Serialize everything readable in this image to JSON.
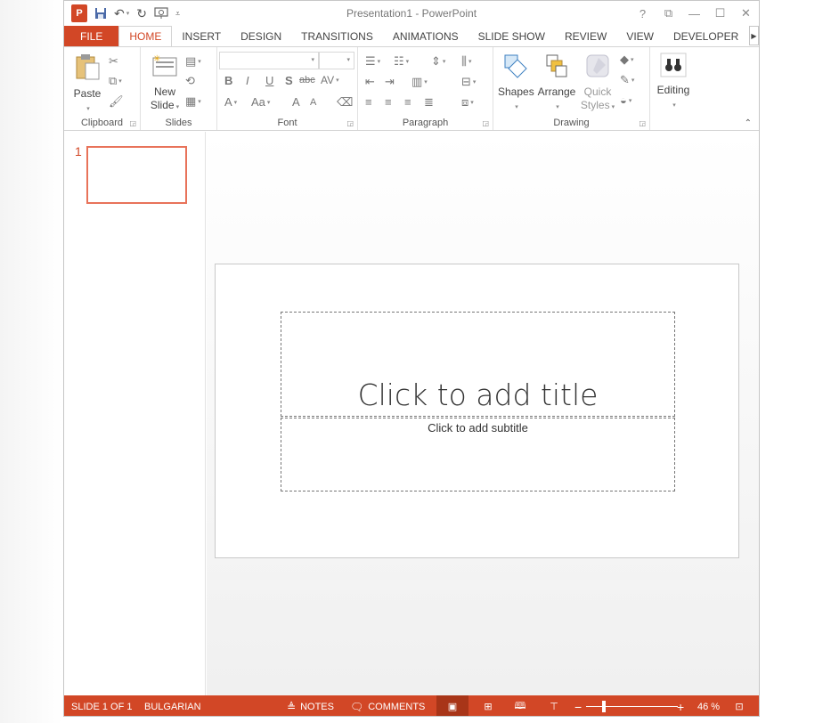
{
  "window": {
    "title": "Presentation1 - PowerPoint"
  },
  "qat": {
    "logo_letter": "P"
  },
  "title_controls": {
    "help": "?",
    "restore_ribbon": "⧉",
    "minimize": "—",
    "maximize": "☐",
    "close": "✕"
  },
  "tabs": [
    {
      "label": "FILE"
    },
    {
      "label": "HOME"
    },
    {
      "label": "INSERT"
    },
    {
      "label": "DESIGN"
    },
    {
      "label": "TRANSITIONS"
    },
    {
      "label": "ANIMATIONS"
    },
    {
      "label": "SLIDE SHOW"
    },
    {
      "label": "REVIEW"
    },
    {
      "label": "VIEW"
    },
    {
      "label": "DEVELOPER"
    }
  ],
  "ribbon": {
    "groups": {
      "clipboard": "Clipboard",
      "slides": "Slides",
      "font": "Font",
      "paragraph": "Paragraph",
      "drawing": "Drawing"
    },
    "paste_label": "Paste",
    "new_slide_label_1": "New",
    "new_slide_label_2": "Slide",
    "shapes_label": "Shapes",
    "arrange_label": "Arrange",
    "quick_styles_label_1": "Quick",
    "quick_styles_label_2": "Styles",
    "editing_label": "Editing",
    "font_buttons": {
      "bold": "B",
      "italic": "I",
      "underline": "U",
      "shadow": "S",
      "strike": "abc",
      "spacing": "AV",
      "font_color": "A",
      "change_case": "Aa",
      "grow": "A",
      "shrink": "A"
    }
  },
  "thumbnails": [
    {
      "number": "1"
    }
  ],
  "slide": {
    "title_placeholder": "Click to add title",
    "subtitle_placeholder": "Click to add subtitle"
  },
  "statusbar": {
    "slide_info": "SLIDE 1 OF 1",
    "language": "BULGARIAN",
    "notes": "NOTES",
    "comments": "COMMENTS",
    "zoom_minus": "−",
    "zoom_plus": "+",
    "zoom_level": "46 %"
  },
  "colors": {
    "accent": "#d24726",
    "thumb_border": "#e8735a"
  }
}
